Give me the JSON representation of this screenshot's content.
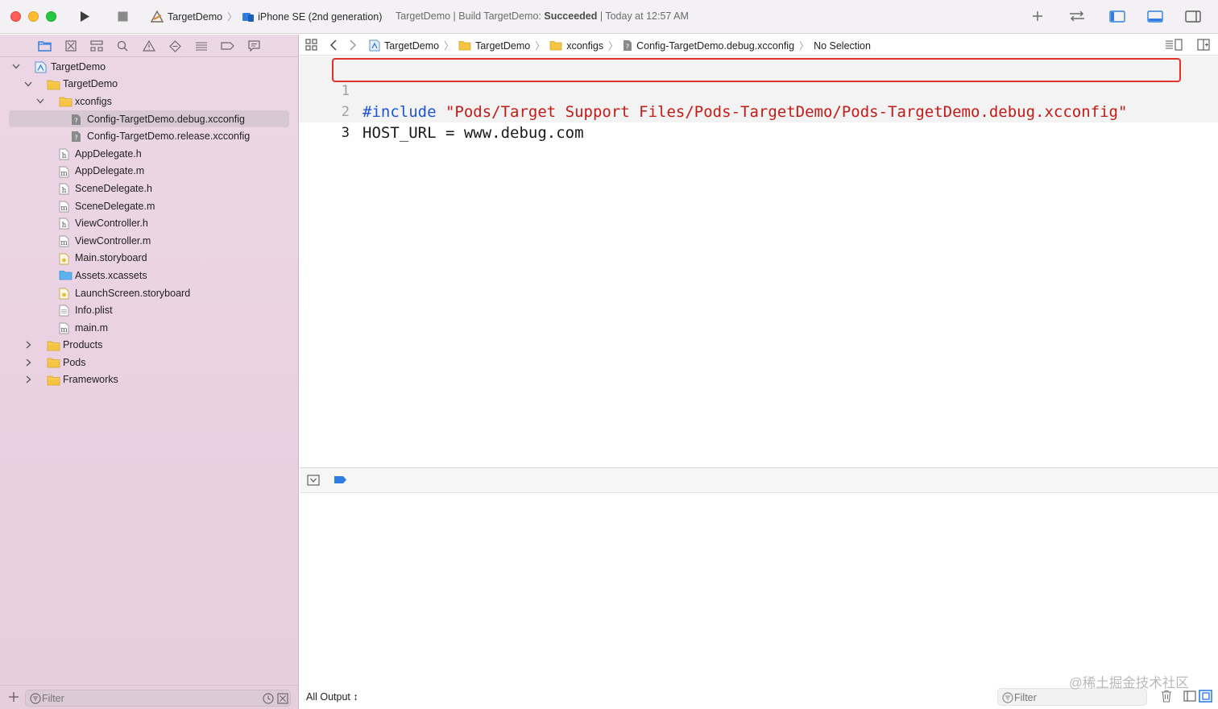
{
  "toolbar": {
    "scheme_target": "TargetDemo",
    "scheme_device": "iPhone SE (2nd generation)",
    "status_prefix": "TargetDemo | Build TargetDemo: ",
    "status_result": "Succeeded",
    "status_time": " | Today at 12:57 AM",
    "icons": [
      "run-icon",
      "stop-icon",
      "add-icon",
      "swap-icon",
      "navigator-toggle-icon",
      "debug-toggle-icon",
      "inspector-toggle-icon"
    ]
  },
  "navigator": {
    "tabs": [
      "folder-icon",
      "source-control-icon",
      "hierarchy-icon",
      "search-icon",
      "warning-icon",
      "test-icon",
      "debug-nav-icon",
      "breakpoint-icon",
      "report-icon"
    ],
    "tree": [
      {
        "label": "TargetDemo",
        "type": "project",
        "disclosure": "open"
      },
      {
        "label": "TargetDemo",
        "type": "folder",
        "disclosure": "open"
      },
      {
        "label": "xconfigs",
        "type": "folder",
        "disclosure": "open"
      },
      {
        "label": "Config-TargetDemo.debug.xcconfig",
        "type": "xcconfig",
        "selected": true
      },
      {
        "label": "Config-TargetDemo.release.xcconfig",
        "type": "xcconfig"
      },
      {
        "label": "AppDelegate.h",
        "type": "h"
      },
      {
        "label": "AppDelegate.m",
        "type": "m"
      },
      {
        "label": "SceneDelegate.h",
        "type": "h"
      },
      {
        "label": "SceneDelegate.m",
        "type": "m"
      },
      {
        "label": "ViewController.h",
        "type": "h"
      },
      {
        "label": "ViewController.m",
        "type": "m"
      },
      {
        "label": "Main.storyboard",
        "type": "storyboard"
      },
      {
        "label": "Assets.xcassets",
        "type": "assets"
      },
      {
        "label": "LaunchScreen.storyboard",
        "type": "storyboard"
      },
      {
        "label": "Info.plist",
        "type": "plist"
      },
      {
        "label": "main.m",
        "type": "m"
      },
      {
        "label": "Products",
        "type": "folder",
        "disclosure": "closed"
      },
      {
        "label": "Pods",
        "type": "folder",
        "disclosure": "closed"
      },
      {
        "label": "Frameworks",
        "type": "folder",
        "disclosure": "closed"
      }
    ],
    "filter_placeholder": "Filter"
  },
  "jumpbar": {
    "crumbs": [
      "TargetDemo",
      "TargetDemo",
      "xconfigs",
      "Config-TargetDemo.debug.xcconfig",
      "No Selection"
    ]
  },
  "editor": {
    "lines": [
      {
        "number": "1",
        "keyword": "#include",
        "rest": " \"Pods/Target Support Files/Pods-TargetDemo/Pods-TargetDemo.debug.xcconfig\""
      },
      {
        "number": "2",
        "keyword": "",
        "rest": "HOST_URL = www.debug.com"
      },
      {
        "number": "3",
        "keyword": "",
        "rest": ""
      }
    ]
  },
  "debug": {
    "output_selector": "All Output ↕",
    "filter_placeholder": "Filter"
  },
  "watermark": "@稀土掘金技术社区",
  "colors": {
    "accent": "#1f53d6",
    "keyword": "#1f53d6",
    "string": "#c41a16",
    "highlight_box": "#e0332b",
    "folder": "#f5c542"
  }
}
